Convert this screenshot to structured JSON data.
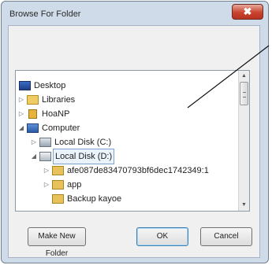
{
  "window": {
    "title": "Browse For Folder",
    "close_glyph": "✖"
  },
  "tree": {
    "items": [
      {
        "label": "Desktop",
        "icon": "desktop-icon",
        "expander": ""
      },
      {
        "label": "Libraries",
        "icon": "libraries-icon",
        "expander": "▷"
      },
      {
        "label": "HoaNP",
        "icon": "user-folder-icon",
        "expander": "▷"
      },
      {
        "label": "Computer",
        "icon": "computer-icon",
        "expander": "◢"
      },
      {
        "label": "Local Disk (C:)",
        "icon": "drive-icon",
        "expander": "▷"
      },
      {
        "label": "Local Disk (D:)",
        "icon": "drive-icon",
        "expander": "◢"
      },
      {
        "label": "afe087de83470793bf6dec1742349:1",
        "icon": "folder-icon",
        "expander": "▷"
      },
      {
        "label": "app",
        "icon": "folder-icon",
        "expander": "▷"
      },
      {
        "label": "Backup kayoe",
        "icon": "folder-icon",
        "expander": ""
      }
    ],
    "selected": "Local Disk (D:)"
  },
  "buttons": {
    "new_folder": "Make New Folder",
    "ok": "OK",
    "cancel": "Cancel"
  },
  "scroll": {
    "up": "▲",
    "down": "▼"
  },
  "colors": {
    "close": "#c8442e",
    "selection": "#7da2ce",
    "folder": "#e8c15a"
  }
}
